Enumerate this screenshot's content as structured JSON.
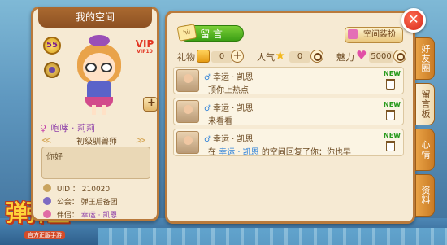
{
  "colors": {
    "panel_bg": "#f6ead3",
    "panel_border": "#b97a3b",
    "accent_purple": "#8e3fa9",
    "link_blue": "#2f82d8",
    "green": "#3c9f15",
    "close_red": "#d5271a"
  },
  "logo": {
    "text": "弹弹堂",
    "sub": "官方正版手游"
  },
  "profile": {
    "title": "我的空间",
    "level": "55",
    "vip": "VIP",
    "vip_sub": "VIP10",
    "name": "咆哮 · 莉莉",
    "title_text": "初级驯兽师",
    "bio": "你好",
    "uid": "UID ：  210020",
    "guild": "公会：  弹王后备团",
    "partner_label": "伴侣：",
    "partner_value": "幸运 · 凯恩"
  },
  "main": {
    "post_button": "留 言",
    "post_icon": "hi!",
    "decorate_button": "空间装扮",
    "stats": {
      "gift_label": "礼物",
      "gift_value": "0",
      "popularity_label": "人气",
      "popularity_value": "0",
      "charm_label": "魅力",
      "charm_value": "5000"
    },
    "messages": [
      {
        "name": "幸运 · 凯恩",
        "text": "顶你上热点",
        "badge": "NEW"
      },
      {
        "name": "幸运 · 凯恩",
        "text": "来看看",
        "badge": "NEW"
      },
      {
        "name": "幸运 · 凯恩",
        "text_pre": "在",
        "text_link": "幸运 · 凯恩",
        "text_post": "的空间回复了你：你也早",
        "badge": "NEW"
      }
    ]
  },
  "tabs": [
    {
      "label": "好友圈"
    },
    {
      "label": "留言板"
    },
    {
      "label": "心情"
    },
    {
      "label": "资料"
    }
  ],
  "close": "✕"
}
